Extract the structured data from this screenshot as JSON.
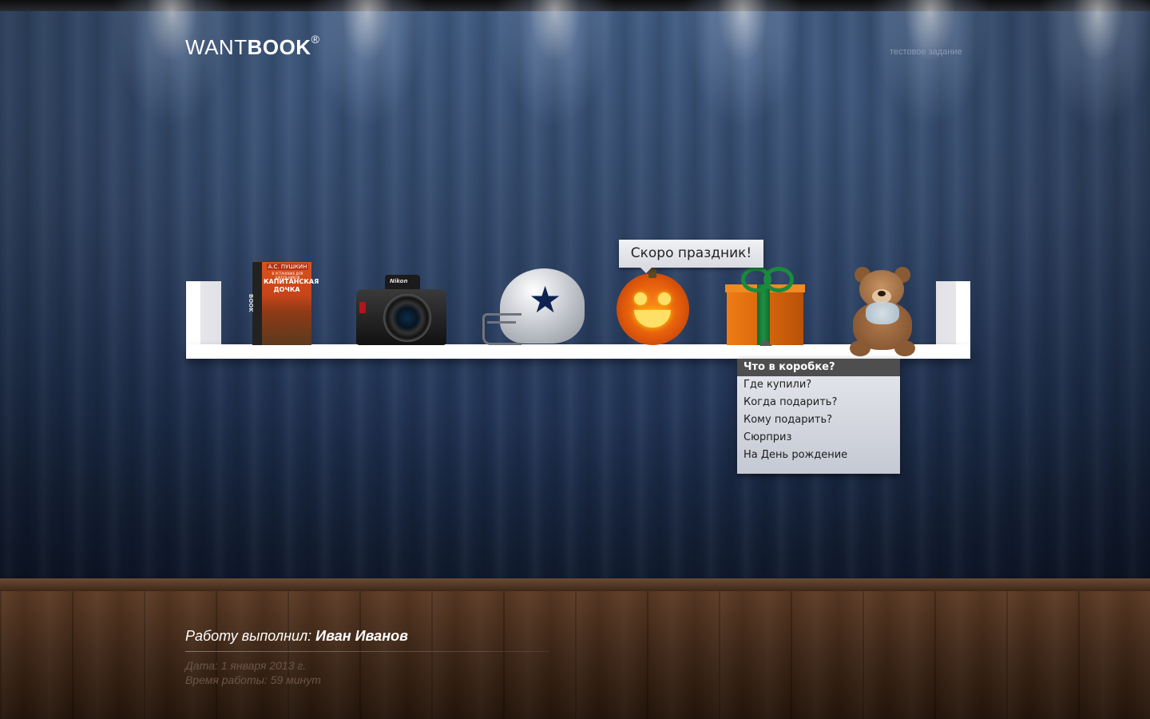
{
  "header": {
    "logo_thin": "WANT",
    "logo_bold": "BOOK",
    "logo_mark": "®",
    "top_link": "тестовое задание"
  },
  "shelf": {
    "items": [
      {
        "name": "book",
        "author": "А.С. ПУШКИН",
        "subtitle": "В УСТАНОВКЕ ДЛЯ ШКОЛЬНИКОВ",
        "title": "КАПИТАНСКАЯ ДОЧКА",
        "spine": "BOOK"
      },
      {
        "name": "camera",
        "brand": "Nikon"
      },
      {
        "name": "helmet"
      },
      {
        "name": "pumpkin"
      },
      {
        "name": "gift"
      },
      {
        "name": "teddy-bear"
      }
    ],
    "tooltip": "Скоро праздник!"
  },
  "menu": {
    "items": [
      {
        "label": "Что в коробке?",
        "active": true
      },
      {
        "label": "Где купили?"
      },
      {
        "label": "Когда подарить?"
      },
      {
        "label": "Кому подарить?"
      },
      {
        "label": "Сюрприз"
      },
      {
        "label": "На День рождение"
      }
    ]
  },
  "footer": {
    "credits_prefix": "Работу выполнил: ",
    "credits_name": "Иван Иванов",
    "date": "Дата: 1 января 2013 г.",
    "work_time": "Время работы: 59 минут"
  },
  "colors": {
    "wall": "#2e4468",
    "floor": "#3e2616",
    "shelf": "#ffffff",
    "menu_active": "#4e4e4e"
  }
}
